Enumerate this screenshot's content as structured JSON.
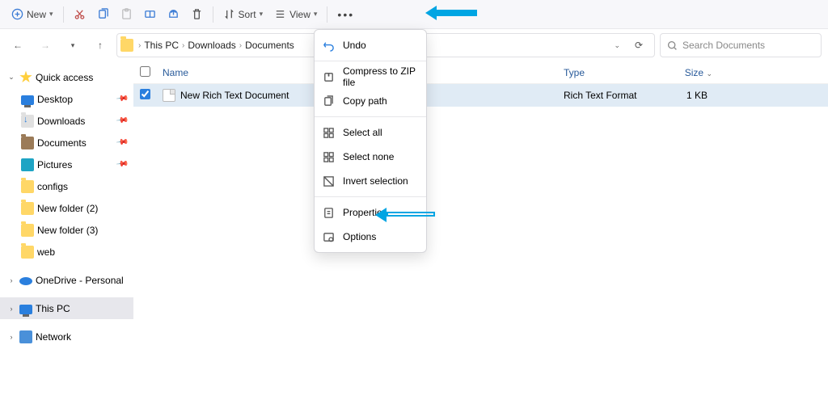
{
  "toolbar": {
    "new_label": "New",
    "sort_label": "Sort",
    "view_label": "View"
  },
  "breadcrumb": [
    "This PC",
    "Downloads",
    "Documents"
  ],
  "search_placeholder": "Search Documents",
  "sidebar": {
    "quick_access": "Quick access",
    "items": [
      {
        "label": "Desktop"
      },
      {
        "label": "Downloads"
      },
      {
        "label": "Documents"
      },
      {
        "label": "Pictures"
      },
      {
        "label": "configs"
      },
      {
        "label": "New folder (2)"
      },
      {
        "label": "New folder (3)"
      },
      {
        "label": "web"
      }
    ],
    "onedrive": "OneDrive - Personal",
    "this_pc": "This PC",
    "network": "Network"
  },
  "columns": {
    "name": "Name",
    "date": "",
    "type": "Type",
    "size": "Size"
  },
  "file": {
    "name": "New Rich Text Document",
    "date": "",
    "type": "Rich Text Format",
    "size": "1 KB"
  },
  "menu": {
    "undo": "Undo",
    "zip": "Compress to ZIP file",
    "copypath": "Copy path",
    "selectall": "Select all",
    "selectnone": "Select none",
    "invert": "Invert selection",
    "properties": "Properties",
    "options": "Options"
  }
}
